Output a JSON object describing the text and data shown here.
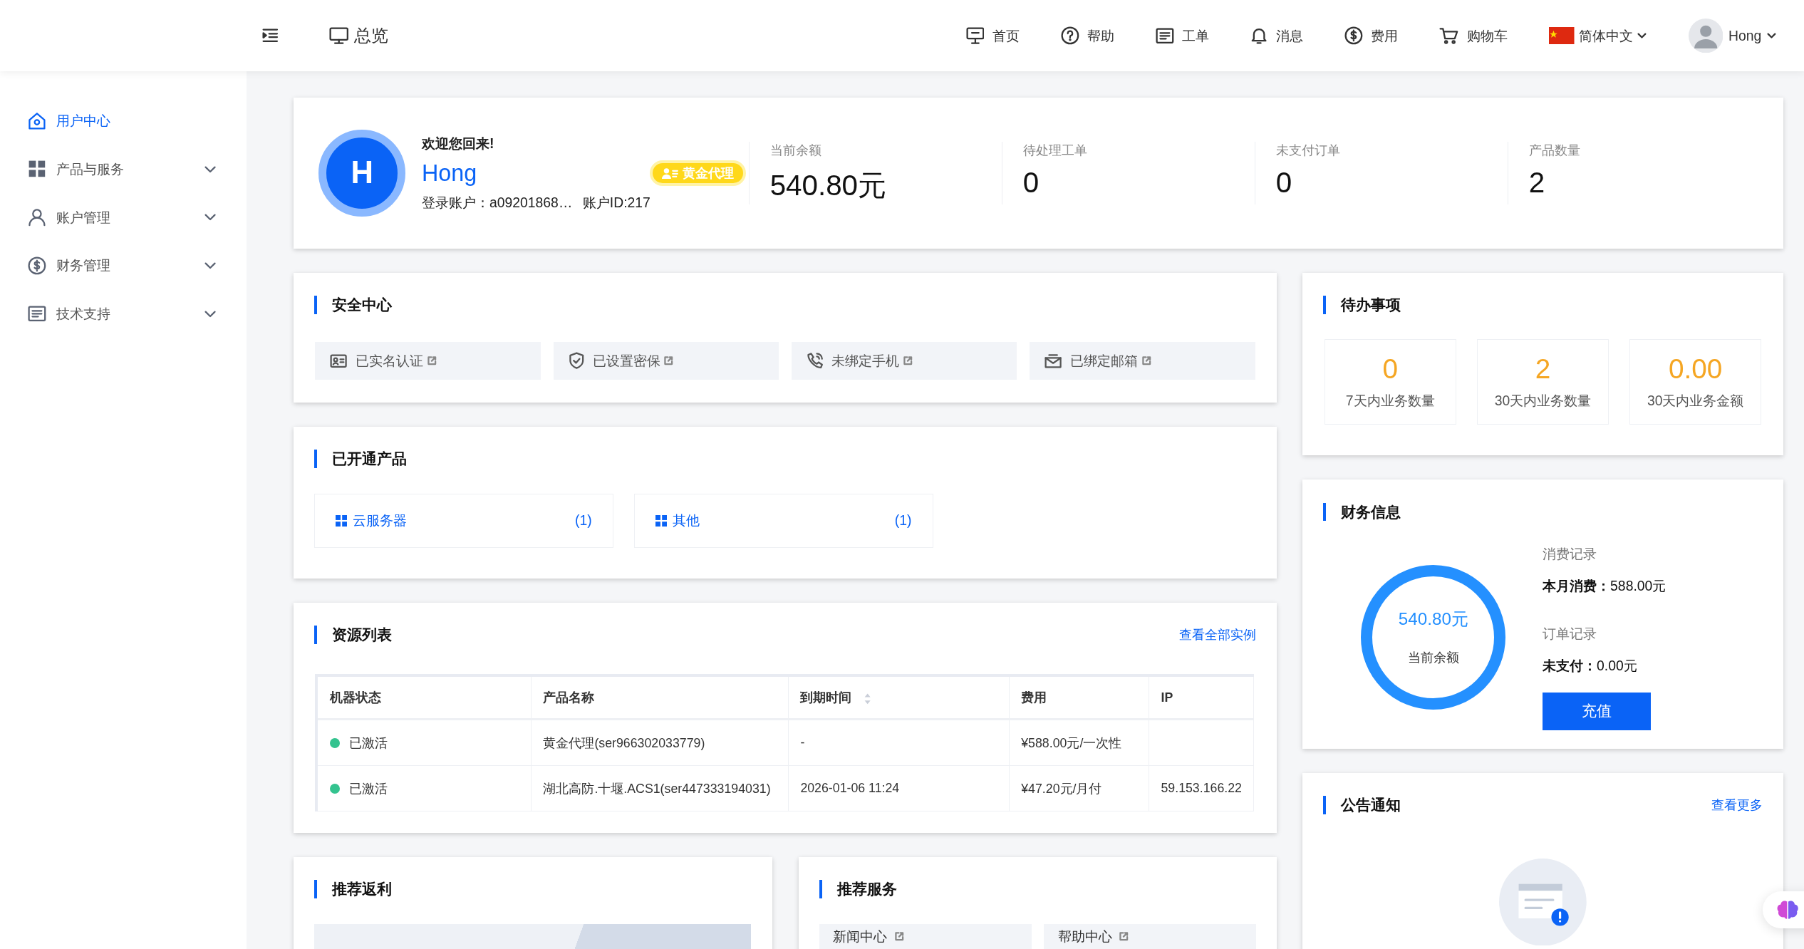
{
  "topbar": {
    "title": "总览",
    "nav": [
      {
        "label": "首页"
      },
      {
        "label": "帮助"
      },
      {
        "label": "工单"
      },
      {
        "label": "消息"
      },
      {
        "label": "费用"
      },
      {
        "label": "购物车"
      }
    ],
    "language": "简体中文",
    "user": "Hong"
  },
  "sidebar": {
    "items": [
      {
        "label": "用户中心",
        "selected": true,
        "kind": "link"
      },
      {
        "label": "产品与服务",
        "selected": false,
        "kind": "group"
      },
      {
        "label": "账户管理",
        "selected": false,
        "kind": "group"
      },
      {
        "label": "财务管理",
        "selected": false,
        "kind": "group"
      },
      {
        "label": "技术支持",
        "selected": false,
        "kind": "group"
      }
    ]
  },
  "profile": {
    "avatar": "H",
    "greeting": "欢迎您回来!",
    "name": "Hong",
    "badge": "黄金代理",
    "account": "登录账户：a09201868…",
    "account_id": "账户ID:217",
    "stats": [
      {
        "label": "当前余额",
        "value": "540.80元"
      },
      {
        "label": "待处理工单",
        "value": "0"
      },
      {
        "label": "未支付订单",
        "value": "0"
      },
      {
        "label": "产品数量",
        "value": "2"
      }
    ]
  },
  "security": {
    "title": "安全中心",
    "items": [
      {
        "label": "已实名认证"
      },
      {
        "label": "已设置密保"
      },
      {
        "label": "未绑定手机"
      },
      {
        "label": "已绑定邮箱"
      }
    ]
  },
  "products": {
    "title": "已开通产品",
    "items": [
      {
        "label": "云服务器",
        "count": "(1)"
      },
      {
        "label": "其他",
        "count": "(1)"
      }
    ]
  },
  "resources": {
    "title": "资源列表",
    "link": "查看全部实例",
    "columns": [
      {
        "label": "机器状态",
        "sortable": false
      },
      {
        "label": "产品名称",
        "sortable": false
      },
      {
        "label": "到期时间",
        "sortable": true
      },
      {
        "label": "费用",
        "sortable": false
      },
      {
        "label": "IP",
        "sortable": false
      }
    ],
    "rows": [
      {
        "color": "#34c38f",
        "cells": [
          "已激活",
          "黄金代理(ser966302033779)",
          "-",
          "¥588.00元/一次性",
          ""
        ]
      },
      {
        "color": "#34c38f",
        "cells": [
          "已激活",
          "湖北高防.十堰.ACS1(ser447333194031)",
          "2026-01-06 11:24",
          "¥47.20元/月付",
          "59.153.166.22"
        ]
      }
    ]
  },
  "todo": {
    "title": "待办事项",
    "items": [
      {
        "value": "0",
        "label": "7天内业务数量"
      },
      {
        "value": "2",
        "label": "30天内业务数量"
      },
      {
        "value": "0.00",
        "label": "30天内业务金额"
      }
    ]
  },
  "finance": {
    "title": "财务信息",
    "ring": {
      "amount": "540.80元",
      "label": "当前余额"
    },
    "records": [
      {
        "heading": "消费记录",
        "line": "**本月消费：**588.00元"
      },
      {
        "heading": "订单记录",
        "line": "**未支付：**0.00元"
      }
    ],
    "button": "充值"
  },
  "notice": {
    "title": "公告通知",
    "link": "查看更多"
  },
  "rebate": {
    "title": "推荐返利"
  },
  "services": {
    "title": "推荐服务",
    "items": [
      {
        "label": "新闻中心"
      },
      {
        "label": "帮助中心"
      }
    ]
  }
}
